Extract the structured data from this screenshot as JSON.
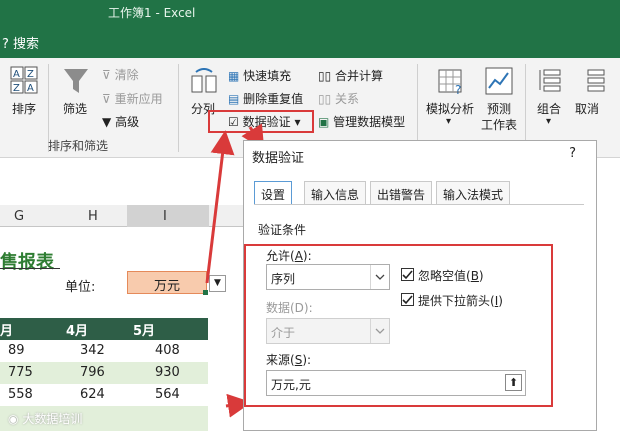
{
  "app": {
    "title": "工作簿1  -  Excel",
    "search": "搜索"
  },
  "ribbon": {
    "sort_label": "排序",
    "filter_label": "筛选",
    "clear_label": "清除",
    "reapply_label": "重新应用",
    "advanced_label": "高级",
    "group_sort_filter": "排序和筛选",
    "split_label": "分列",
    "flash_fill": "快速填充",
    "remove_dup": "删除重复值",
    "data_validation": "数据验证",
    "consolidate": "合并计算",
    "relationships": "关系",
    "manage_model": "管理数据模型",
    "whatif_label": "模拟分析",
    "forecast_label": "预测",
    "forecast_sub": "工作表",
    "group_label": "组合",
    "ungroup_label": "取消"
  },
  "sheet": {
    "col_headers": [
      "G",
      "H",
      "I"
    ],
    "heading": "售报表",
    "unit_label": "单位:",
    "unit_value": "万元",
    "months": [
      "月",
      "4月",
      "5月"
    ],
    "rows": [
      [
        "89",
        "342",
        "408"
      ],
      [
        "775",
        "796",
        "930"
      ],
      [
        "558",
        "624",
        "564"
      ]
    ]
  },
  "dialog": {
    "title": "数据验证",
    "help": "?",
    "tabs": [
      "设置",
      "输入信息",
      "出错警告",
      "输入法模式"
    ],
    "section_label": "验证条件",
    "allow_label": "允许(",
    "allow_key": "A",
    "allow_value": "序列",
    "data_label": "数据(D):",
    "data_value": "介于",
    "ignore_blank_label": "忽略空值(",
    "ignore_blank_key": "B",
    "dropdown_label": "提供下拉箭头(",
    "dropdown_key": "I",
    "source_label": "来源(",
    "source_key": "S",
    "source_value": "万元,元"
  },
  "watermark": "大数据培训",
  "colors": {
    "excel_green": "#217346",
    "highlight_red": "#d93a3a",
    "unit_fill": "#f8cbad",
    "row_fill": "#e2efda"
  }
}
